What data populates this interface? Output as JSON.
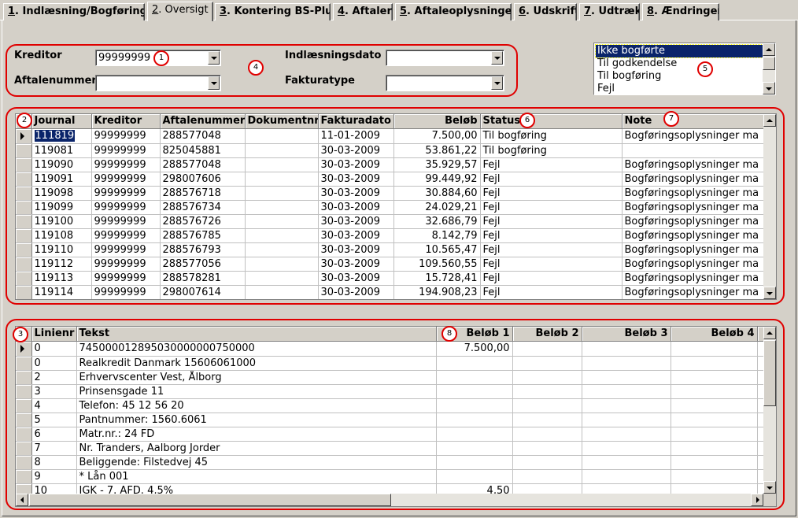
{
  "tabs": [
    {
      "num": "1",
      "label": ". Indlæsning/Bogføring"
    },
    {
      "num": "2",
      "label": ". Oversigt"
    },
    {
      "num": "3",
      "label": ". Kontering BS-Plus"
    },
    {
      "num": "4",
      "label": ". Aftaler"
    },
    {
      "num": "5",
      "label": ". Aftaleoplysninger"
    },
    {
      "num": "6",
      "label": ". Udskrift"
    },
    {
      "num": "7",
      "label": ". Udtræk"
    },
    {
      "num": "8",
      "label": ". Ændringer"
    }
  ],
  "filters": {
    "kreditor_label": "Kreditor",
    "kreditor_value": "99999999",
    "aftalenummer_label": "Aftalenummer",
    "aftalenummer_value": "",
    "indlaesningsdato_label": "Indlæsningsdato",
    "indlaesningsdato_value": "",
    "fakturatype_label": "Fakturatype",
    "fakturatype_value": ""
  },
  "status_list": {
    "items": [
      "Ikke bogførte",
      "Til godkendelse",
      "Til bogføring",
      "Fejl"
    ],
    "selected": "Ikke bogførte"
  },
  "callouts": [
    "1",
    "2",
    "3",
    "4",
    "5",
    "6",
    "7",
    "8"
  ],
  "journal_grid": {
    "columns": [
      "Journal",
      "Kreditor",
      "Aftalenummer",
      "Dokumentnr",
      "Fakturadato",
      "Beløb",
      "Status",
      "Note"
    ],
    "rows": [
      [
        "111819",
        "99999999",
        "288577048",
        "",
        "11-01-2009",
        "7.500,00",
        "Til bogføring",
        "Bogføringsoplysninger ma"
      ],
      [
        "119081",
        "99999999",
        "825045881",
        "",
        "30-03-2009",
        "53.861,22",
        "Til bogføring",
        ""
      ],
      [
        "119090",
        "99999999",
        "288577048",
        "",
        "30-03-2009",
        "35.929,57",
        "Fejl",
        "Bogføringsoplysninger ma"
      ],
      [
        "119091",
        "99999999",
        "298007606",
        "",
        "30-03-2009",
        "99.449,92",
        "Fejl",
        "Bogføringsoplysninger ma"
      ],
      [
        "119098",
        "99999999",
        "288576718",
        "",
        "30-03-2009",
        "30.884,60",
        "Fejl",
        "Bogføringsoplysninger ma"
      ],
      [
        "119099",
        "99999999",
        "288576734",
        "",
        "30-03-2009",
        "24.029,21",
        "Fejl",
        "Bogføringsoplysninger ma"
      ],
      [
        "119100",
        "99999999",
        "288576726",
        "",
        "30-03-2009",
        "32.686,79",
        "Fejl",
        "Bogføringsoplysninger ma"
      ],
      [
        "119108",
        "99999999",
        "288576785",
        "",
        "30-03-2009",
        "8.142,79",
        "Fejl",
        "Bogføringsoplysninger ma"
      ],
      [
        "119110",
        "99999999",
        "288576793",
        "",
        "30-03-2009",
        "10.565,47",
        "Fejl",
        "Bogføringsoplysninger ma"
      ],
      [
        "119112",
        "99999999",
        "288577056",
        "",
        "30-03-2009",
        "109.560,55",
        "Fejl",
        "Bogføringsoplysninger ma"
      ],
      [
        "119113",
        "99999999",
        "288578281",
        "",
        "30-03-2009",
        "15.728,41",
        "Fejl",
        "Bogføringsoplysninger ma"
      ],
      [
        "119114",
        "99999999",
        "298007614",
        "",
        "30-03-2009",
        "194.908,23",
        "Fejl",
        "Bogføringsoplysninger ma"
      ]
    ]
  },
  "line_grid": {
    "columns": [
      "Linienr",
      "Tekst",
      "Beløb 1",
      "Beløb 2",
      "Beløb 3",
      "Beløb 4"
    ],
    "rows": [
      [
        "0",
        "745000012895030000000750000",
        "7.500,00",
        "",
        "",
        ""
      ],
      [
        "0",
        "Realkredit Danmark 15606061000",
        "",
        "",
        "",
        ""
      ],
      [
        "2",
        "Erhvervscenter Vest, Ålborg",
        "",
        "",
        "",
        ""
      ],
      [
        "3",
        "Prinsensgade 11",
        "",
        "",
        "",
        ""
      ],
      [
        "4",
        "Telefon: 45 12 56 20",
        "",
        "",
        "",
        ""
      ],
      [
        "5",
        "Pantnummer: 1560.6061",
        "",
        "",
        "",
        ""
      ],
      [
        "6",
        "Matr.nr.: 24 FD",
        "",
        "",
        "",
        ""
      ],
      [
        "7",
        "Nr. Tranders, Aalborg Jorder",
        "",
        "",
        "",
        ""
      ],
      [
        "8",
        "Beliggende: Filstedvej 45",
        "",
        "",
        "",
        ""
      ],
      [
        "9",
        "* Lån 001",
        "",
        "",
        "",
        ""
      ],
      [
        "10",
        " JGK - 7. AFD. 4,5%",
        "4,50",
        "",
        "",
        ""
      ]
    ]
  }
}
